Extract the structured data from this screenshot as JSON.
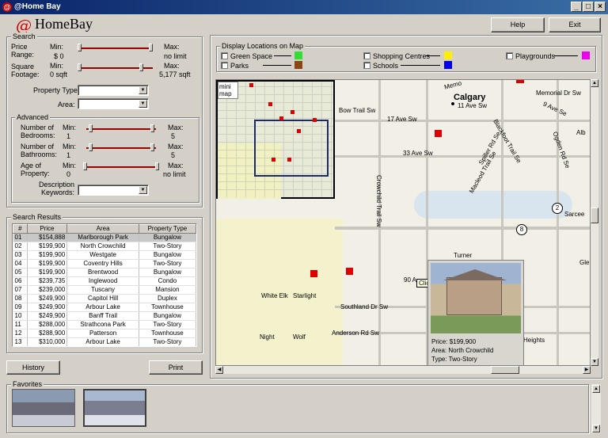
{
  "window": {
    "title": "@Home Bay",
    "min": "_",
    "max": "□",
    "close": "×"
  },
  "brand": {
    "logo_symbol": "@",
    "name": "HomeBay"
  },
  "header": {
    "help": "Help",
    "exit": "Exit"
  },
  "search": {
    "legend": "Search",
    "price": {
      "label": "Price Range:",
      "min_label": "Min:",
      "min_value": "$ 0",
      "max_label": "Max:",
      "max_value": "no limit"
    },
    "sqft": {
      "label": "Square Footage:",
      "min_label": "Min:",
      "min_value": "0 sqft",
      "max_label": "Max:",
      "max_value": "5,177 sqft"
    },
    "property_type_label": "Property Type:",
    "area_label": "Area:",
    "advanced": {
      "legend": "Advanced",
      "bedrooms": {
        "label": "Number of Bedrooms:",
        "min_label": "Min:",
        "min_value": "1",
        "max_label": "Max:",
        "max_value": "5"
      },
      "bathrooms": {
        "label": "Number of Bathrooms:",
        "min_label": "Min:",
        "min_value": "1",
        "max_label": "Max:",
        "max_value": "5"
      },
      "age": {
        "label": "Age of Property:",
        "min_label": "Min:",
        "min_value": "0",
        "max_label": "Max:",
        "max_value": "no limit"
      },
      "keywords_label": "Description Keywords:"
    }
  },
  "results": {
    "legend": "Search Results",
    "columns": [
      "#",
      "Price",
      "Area",
      "Property Type"
    ],
    "rows": [
      [
        "01",
        "$154,888",
        "Marlborough Park",
        "Bungalow"
      ],
      [
        "02",
        "$199,900",
        "North Crowchild",
        "Two-Story"
      ],
      [
        "03",
        "$199,900",
        "Westgate",
        "Bungalow"
      ],
      [
        "04",
        "$199,900",
        "Coventry Hills",
        "Two-Story"
      ],
      [
        "05",
        "$199,900",
        "Brentwood",
        "Bungalow"
      ],
      [
        "06",
        "$239,735",
        "Inglewood",
        "Condo"
      ],
      [
        "07",
        "$239,000",
        "Tuscany",
        "Mansion"
      ],
      [
        "08",
        "$249,900",
        "Capitol Hill",
        "Duplex"
      ],
      [
        "09",
        "$249,900",
        "Arbour Lake",
        "Townhouse"
      ],
      [
        "10",
        "$249,900",
        "Banff Trail",
        "Bungalow"
      ],
      [
        "11",
        "$288,000",
        "Strathcona Park",
        "Two-Story"
      ],
      [
        "12",
        "$288,900",
        "Patterson",
        "Townhouse"
      ],
      [
        "13",
        "$310,000",
        "Arbour Lake",
        "Two-Story"
      ]
    ]
  },
  "buttons": {
    "history": "History",
    "print": "Print"
  },
  "display": {
    "legend": "Display Locations on Map",
    "items": [
      {
        "label": "Green Space",
        "color": "#33dd33"
      },
      {
        "label": "Parks",
        "color": "#8b4513"
      },
      {
        "label": "Shopping Centres",
        "color": "#ffee00"
      },
      {
        "label": "Schools",
        "color": "#0000ee"
      },
      {
        "label": "Playgrounds",
        "color": "#ee00ee"
      }
    ]
  },
  "map": {
    "mini_map_label": "mini map",
    "city": "Calgary",
    "labels": [
      "11 Ave Sw",
      "Bow Trail Sw",
      "17 Ave Sw",
      "33 Ave Sw",
      "Crowchild Trail Sw",
      "Memorial Dr Sw",
      "9 Ave Se",
      "Alb",
      "Ogden Rd Se",
      "Blackfoot Trail Se",
      "Macleod Trail Se",
      "Spiller Rd Se",
      "Sarcee",
      "Glen",
      "Southland Dr Sw",
      "Anderson Rd Sw",
      "White Elk",
      "Starlight",
      "Night",
      "Wolf",
      "Heights",
      "90 A",
      "Turner",
      "Memo"
    ],
    "route_numbers": [
      "2",
      "8"
    ],
    "tooltip": "Click for details",
    "popup": {
      "price_label": "Price:",
      "price": "$199,900",
      "area_label": "Area:",
      "area": "North Crowchild",
      "type_label": "Type:",
      "type": "Two-Story"
    }
  },
  "favorites": {
    "legend": "Favorites"
  }
}
